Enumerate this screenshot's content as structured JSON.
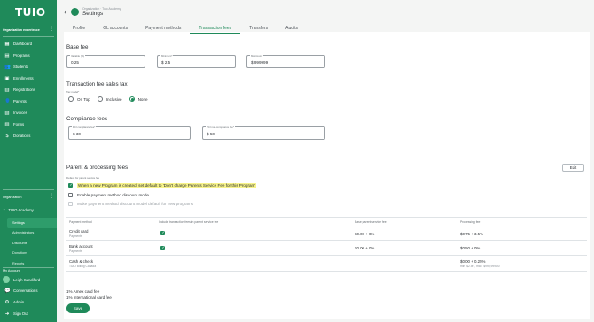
{
  "sidebar": {
    "logo": "TUIO",
    "org_experience": "Organization experience",
    "items": [
      {
        "label": "Dashboard",
        "icon": "grid-icon",
        "glyph": "▦"
      },
      {
        "label": "Programs",
        "icon": "calendar-icon",
        "glyph": "▤"
      },
      {
        "label": "Students",
        "icon": "people-icon",
        "glyph": "👥"
      },
      {
        "label": "Enrollments",
        "icon": "document-icon",
        "glyph": "▣"
      },
      {
        "label": "Registrations",
        "icon": "clipboard-icon",
        "glyph": "▥"
      },
      {
        "label": "Parents",
        "icon": "parents-icon",
        "glyph": "👤"
      },
      {
        "label": "Invoices",
        "icon": "invoice-icon",
        "glyph": "▧"
      },
      {
        "label": "Forms",
        "icon": "form-icon",
        "glyph": "▨"
      },
      {
        "label": "Donations",
        "icon": "dollar-icon",
        "glyph": "$"
      }
    ],
    "organization_label": "Organization",
    "org_name": "TUIO Academy",
    "org_chevron": "⌃",
    "sub_items": [
      {
        "label": "Settings",
        "active": true
      },
      {
        "label": "Administrators",
        "active": false
      },
      {
        "label": "Discounts",
        "active": false
      },
      {
        "label": "Donations",
        "active": false
      },
      {
        "label": "Reports",
        "active": false
      }
    ],
    "my_account": "My Account",
    "user_name": "Leigh Sandiford",
    "bottom_items": [
      {
        "label": "Conversations",
        "icon": "chat-icon",
        "glyph": "💬"
      },
      {
        "label": "Admin",
        "icon": "gear-icon",
        "glyph": "⚙"
      },
      {
        "label": "Sign Out",
        "icon": "sign-out-icon",
        "glyph": "➜"
      }
    ]
  },
  "header": {
    "breadcrumb": "Organization · Tuio Academy",
    "title": "Settings",
    "back_glyph": "‹"
  },
  "tabs": [
    {
      "label": "Profile",
      "active": false
    },
    {
      "label": "GL accounts",
      "active": false
    },
    {
      "label": "Payment methods",
      "active": false
    },
    {
      "label": "Transaction fees",
      "active": true
    },
    {
      "label": "Transfers",
      "active": false
    },
    {
      "label": "Audits",
      "active": false
    }
  ],
  "base_fee": {
    "title": "Base fee",
    "variable_label": "Variable (%)",
    "variable_value": "0.25",
    "minimum_label": "Minimum*",
    "minimum_value": "$ 2.5",
    "maximum_label": "Maximum*",
    "maximum_value": "$ 999999"
  },
  "sales_tax": {
    "title": "Transaction fee sales tax",
    "label": "Tax model*",
    "options": [
      {
        "label": "On Top",
        "selected": false
      },
      {
        "label": "Inclusive",
        "selected": false
      },
      {
        "label": "None",
        "selected": true
      }
    ]
  },
  "compliance": {
    "title": "Compliance fees",
    "pci_label": "PCI compliance fee*",
    "pci_value": "$ 30",
    "non_pci_label": "PCI non-compliance fee*",
    "non_pci_value": "$ 50"
  },
  "parent_fees": {
    "title": "Parent & processing fees",
    "edit_label": "Edit",
    "default_label": "Default for parent service fee",
    "checkboxes": [
      {
        "label": "When a new Program is created, set default to 'Don't charge Parents Service Fee for this Program'",
        "checked": true,
        "highlight": true,
        "muted": false
      },
      {
        "label": "Enable payment method discount mode",
        "checked": false,
        "highlight": false,
        "muted": false
      },
      {
        "label": "Make payment method discount model default for new programs",
        "checked": false,
        "highlight": false,
        "muted": true
      }
    ],
    "columns": [
      "Payment method",
      "Include transaction fees in parent service fee",
      "Base parent service fee",
      "Processing fee"
    ],
    "rows": [
      {
        "method": "Credit card",
        "sub": "Payments",
        "include": true,
        "base": "$0.00 + 0%",
        "processing": "$0.75 + 3.5%",
        "processing_sub": ""
      },
      {
        "method": "Bank account",
        "sub": "Payments",
        "include": true,
        "base": "$0.00 + 0%",
        "processing": "$0.50 + 0%",
        "processing_sub": ""
      },
      {
        "method": "Cash & check",
        "sub": "TUIO Billing Canada",
        "include": false,
        "base": "",
        "processing": "$0.00 + 0.25%",
        "processing_sub": "min: $2.50 , max: $999,999.00"
      }
    ],
    "amex_fee": "1% Amex card fee",
    "intl_fee": "1% international card fee",
    "save_label": "Save"
  },
  "colors": {
    "brand": "#1f8a5a",
    "highlight": "#f7f38a"
  }
}
